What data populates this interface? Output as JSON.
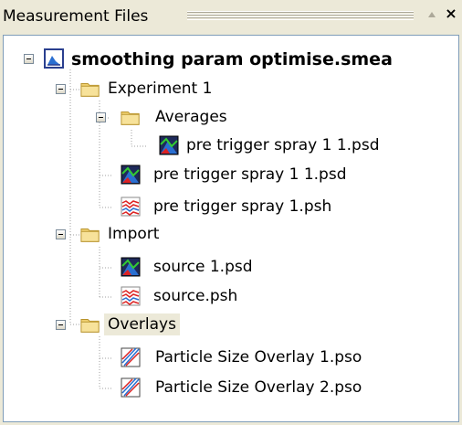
{
  "panel": {
    "title": "Measurement Files",
    "pin_glyph": "▲",
    "close_glyph": "×"
  },
  "tree": {
    "root": {
      "label": "smoothing param optimise.smea",
      "icon": "measurement-file-icon",
      "expanded": true
    },
    "experiment": {
      "label": "Experiment 1",
      "icon": "folder-icon",
      "expanded": true
    },
    "averages": {
      "label": "Averages",
      "icon": "folder-icon",
      "expanded": true
    },
    "avg_psd": {
      "label": "pre trigger spray 1 1.psd",
      "icon": "psd-chart-icon"
    },
    "exp_psd": {
      "label": "pre trigger spray 1 1.psd",
      "icon": "psd-chart-icon"
    },
    "exp_psh": {
      "label": "pre trigger spray 1.psh",
      "icon": "psh-history-icon"
    },
    "import": {
      "label": "Import",
      "icon": "folder-icon",
      "expanded": true
    },
    "import_psd": {
      "label": "source 1.psd",
      "icon": "psd-chart-icon"
    },
    "import_psh": {
      "label": "source.psh",
      "icon": "psh-history-icon"
    },
    "overlays": {
      "label": "Overlays",
      "icon": "folder-icon",
      "expanded": true,
      "selected": true
    },
    "overlay_1": {
      "label": "Particle Size Overlay 1.pso",
      "icon": "overlay-icon"
    },
    "overlay_2": {
      "label": "Particle Size Overlay 2.pso",
      "icon": "overlay-icon"
    }
  },
  "colors": {
    "folder": "#f0d070",
    "selection": "#ece9d8",
    "frame_border": "#7f9db9"
  }
}
